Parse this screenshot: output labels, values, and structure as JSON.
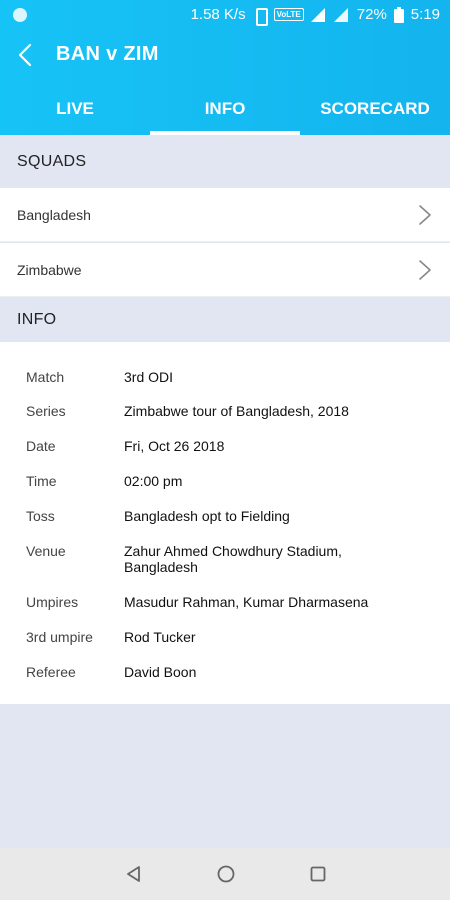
{
  "status_bar": {
    "speed": "1.58 K/s",
    "volte": "VoLTE",
    "battery": "72%",
    "time": "5:19"
  },
  "header": {
    "title": "BAN v ZIM"
  },
  "tabs": [
    {
      "label": "LIVE",
      "active": false
    },
    {
      "label": "INFO",
      "active": true
    },
    {
      "label": "SCORECARD",
      "active": false
    }
  ],
  "squads": {
    "heading": "SQUADS",
    "teams": [
      "Bangladesh",
      "Zimbabwe"
    ]
  },
  "info": {
    "heading": "INFO",
    "rows": [
      {
        "label": "Match",
        "value": "3rd ODI"
      },
      {
        "label": "Series",
        "value": "Zimbabwe tour of Bangladesh, 2018"
      },
      {
        "label": "Date",
        "value": "Fri, Oct 26 2018"
      },
      {
        "label": "Time",
        "value": "02:00 pm"
      },
      {
        "label": "Toss",
        "value": "Bangladesh opt to Fielding"
      },
      {
        "label": "Venue",
        "value": "Zahur Ahmed Chowdhury Stadium, Bangladesh"
      },
      {
        "label": "Umpires",
        "value": "Masudur Rahman, Kumar Dharmasena"
      },
      {
        "label": "3rd umpire",
        "value": "Rod Tucker"
      },
      {
        "label": "Referee",
        "value": "David Boon"
      }
    ]
  },
  "colors": {
    "appbar": "#16c3f6",
    "section_bg": "#e2e6f3"
  }
}
